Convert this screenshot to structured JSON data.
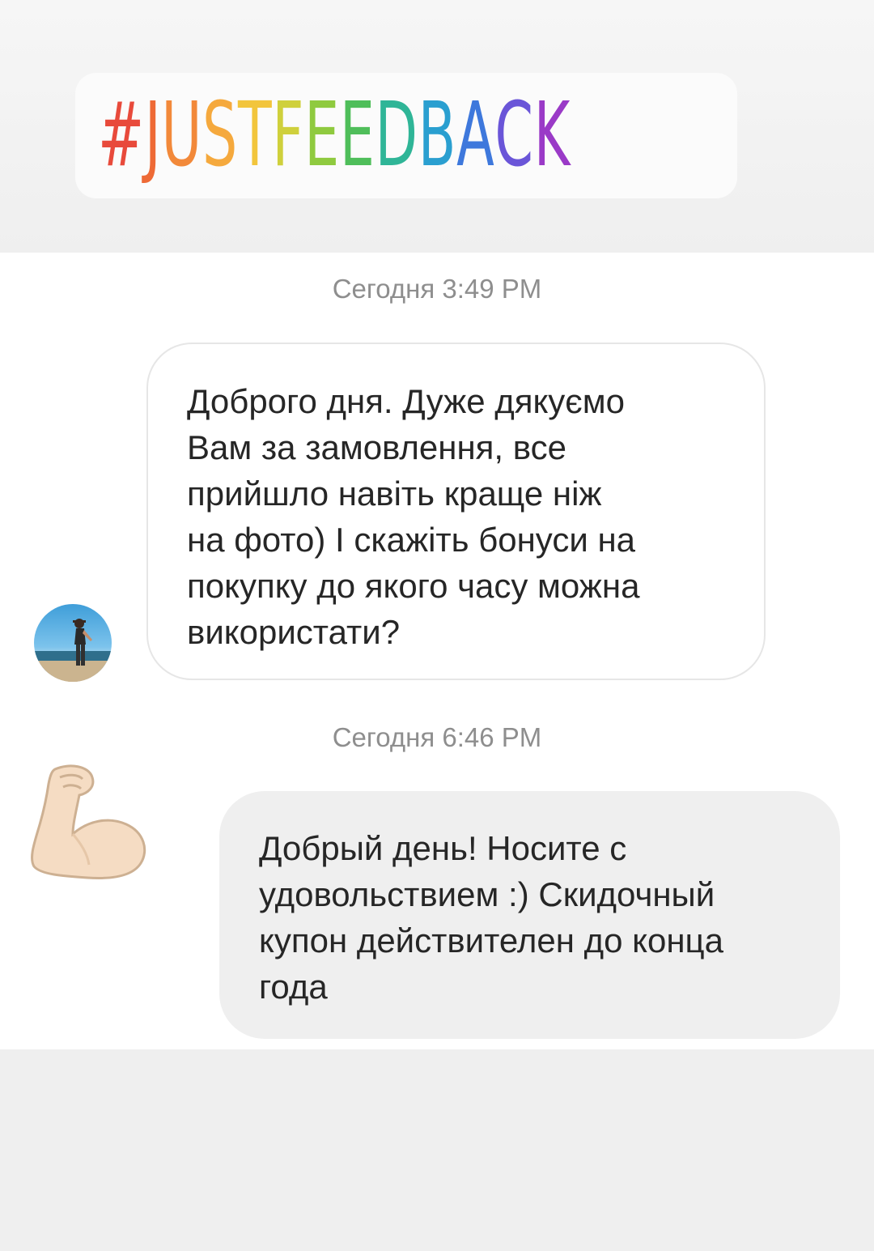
{
  "story": {
    "hashtag": "#JUSTFEEDBACK",
    "hashtag_colors": [
      "#e84a3b",
      "#ee6a36",
      "#f2893a",
      "#f5a93d",
      "#f2c53c",
      "#cfd03c",
      "#8fca3f",
      "#4fbe5a",
      "#2fb597",
      "#2a9fd0",
      "#3e78dc",
      "#6a55d8",
      "#9a3ac7"
    ]
  },
  "chat": {
    "timestamp_1": "Сегодня 3:49 PM",
    "message_in": "Доброго дня. Дуже дякуємо Вам за замовлення, все прийшло навіть краще ніж на фото) І скажіть бонуси на покупку до якого часу можна використати?",
    "message_in_lines": [
      "Доброго дня. Дуже дякуємо",
      "Вам за замовлення, все",
      "прийшло навіть краще ніж",
      "на фото) І скажіть бонуси на",
      "покупку до якого часу можна",
      "використати?"
    ],
    "timestamp_2": "Сегодня 6:46 PM",
    "message_out_lines": [
      "Добрый день! Носите с",
      "удовольствием :) Скидочный",
      "купон действителен до конца",
      "года"
    ],
    "sender_avatar_icon": "user-avatar-photo",
    "sticker_icon": "flexed-biceps-emoji"
  }
}
